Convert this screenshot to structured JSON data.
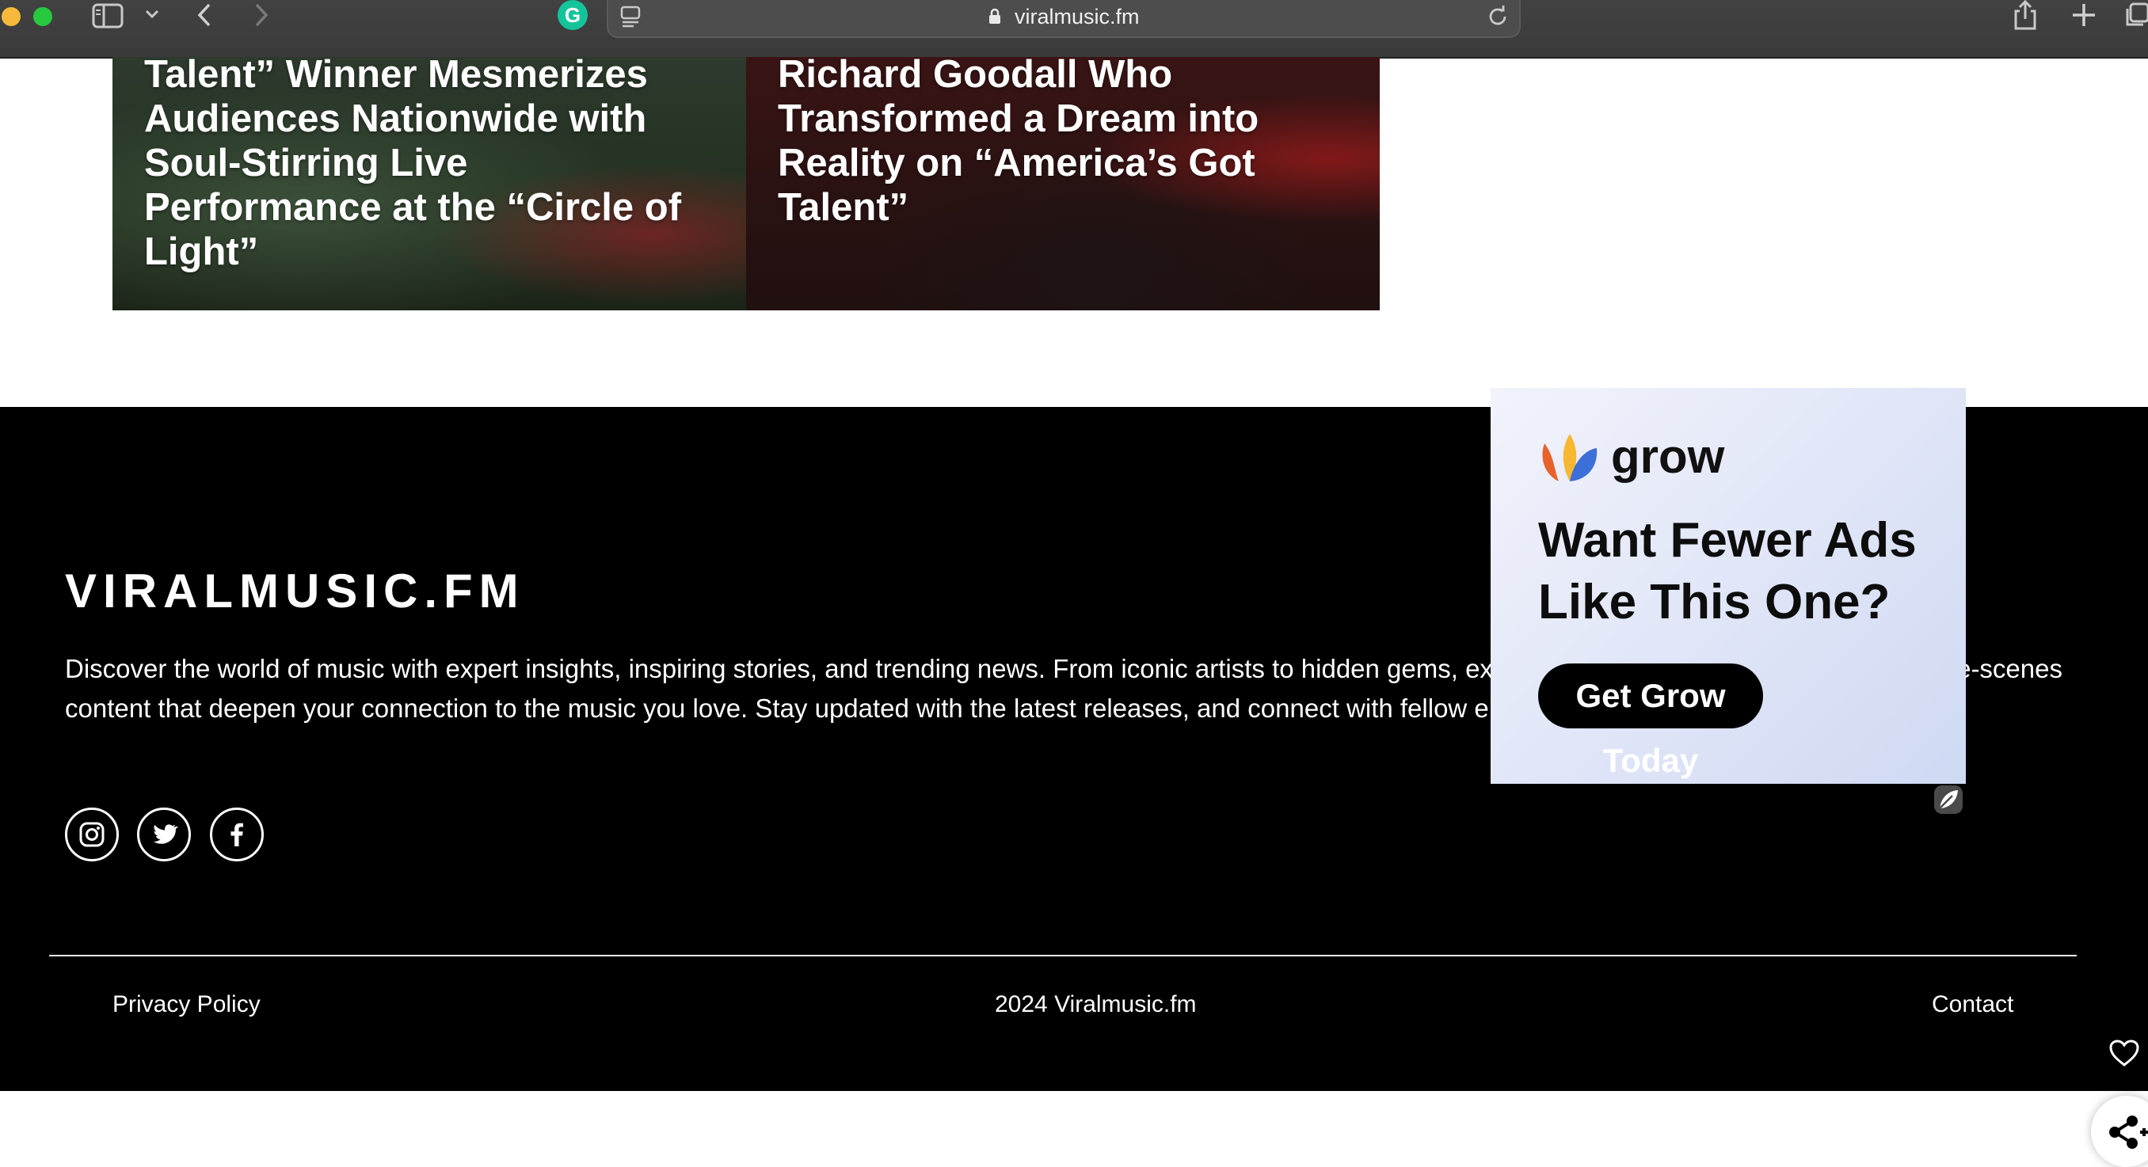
{
  "browser": {
    "url": "viralmusic.fm"
  },
  "articles": [
    {
      "title": "Talent” Winner Mesmerizes Audiences Nationwide with Soul-Stirring Live Performance at the “Circle of Light”"
    },
    {
      "title": "Richard Goodall Who Transformed a Dream into Reality on “America’s Got Talent”"
    }
  ],
  "footer": {
    "brand": "VIRALMUSIC.FM",
    "about": "Discover the world of music with expert insights, inspiring stories, and trending news. From iconic artists to hidden gems, explore exclusive interviews and behind-the-scenes content that deepen your connection to the music you love. Stay updated with the latest releases, and connect with fellow enthusiasts who share your passion.",
    "socials": [
      {
        "icon": "instagram-icon"
      },
      {
        "icon": "twitter-icon"
      },
      {
        "icon": "facebook-icon"
      }
    ],
    "privacy_label": "Privacy Policy",
    "copyright": "2024 Viralmusic.fm",
    "contact_label": "Contact"
  },
  "ad": {
    "brand": "grow",
    "headline": "Want Fewer Ads Like This One?",
    "cta": "Get Grow Today"
  }
}
